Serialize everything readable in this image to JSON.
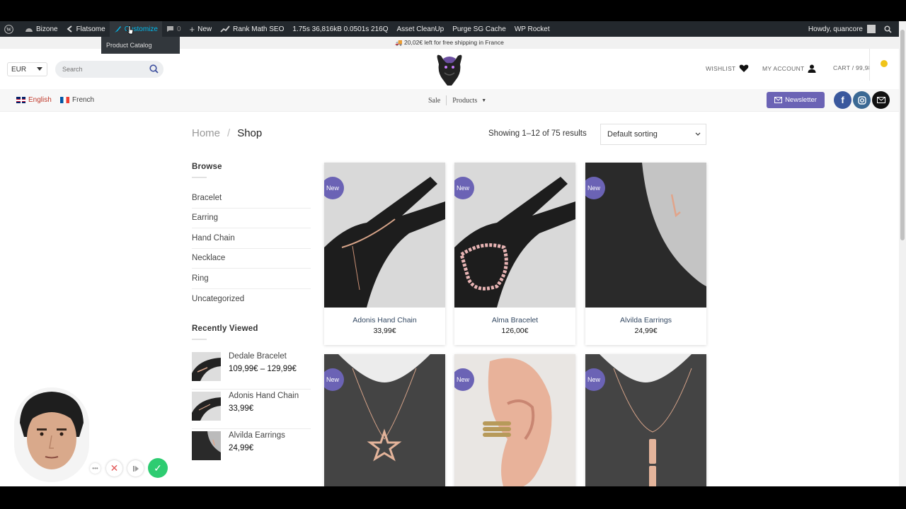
{
  "admin_bar": {
    "site_name": "Bizone",
    "theme": "Flatsome",
    "customize": "Customize",
    "comments_count": "0",
    "new_label": "New",
    "rank_math": "Rank Math SEO",
    "query_stats": "1.75s  36,816kB  0.0501s  216Q",
    "asset_cleanup": "Asset CleanUp",
    "purge_cache": "Purge SG Cache",
    "wp_rocket": "WP Rocket",
    "howdy": "Howdy, quancore",
    "dropdown_item": "Product Catalog"
  },
  "notice": {
    "text": "🚚 20,02€ left for free shipping in France"
  },
  "header": {
    "currency": "EUR",
    "search_placeholder": "Search",
    "wishlist": "WISHLIST",
    "my_account": "MY ACCOUNT",
    "cart": "CART / 99,98"
  },
  "subbar": {
    "lang_english": "English",
    "lang_french": "French",
    "nav_sale": "Sale",
    "nav_products": "Products",
    "newsletter": "Newsletter"
  },
  "shop": {
    "breadcrumb_home": "Home",
    "breadcrumb_sep": "/",
    "breadcrumb_current": "Shop",
    "result_count": "Showing 1–12 of 75 results",
    "sorting": "Default sorting"
  },
  "sidebar": {
    "browse_title": "Browse",
    "categories": [
      "Bracelet",
      "Earring",
      "Hand Chain",
      "Necklace",
      "Ring",
      "Uncategorized"
    ],
    "recently_viewed_title": "Recently Viewed",
    "recent": [
      {
        "name": "Dedale Bracelet",
        "price": "109,99€ – 129,99€"
      },
      {
        "name": "Adonis Hand Chain",
        "price": "33,99€"
      },
      {
        "name": "Alvilda Earrings",
        "price": "24,99€"
      }
    ]
  },
  "products": [
    {
      "badge": "New",
      "name": "Adonis Hand Chain",
      "price": "33,99€"
    },
    {
      "badge": "New",
      "name": "Alma Bracelet",
      "price": "126,00€"
    },
    {
      "badge": "New",
      "name": "Alvilda Earrings",
      "price": "24,99€"
    },
    {
      "badge": "New",
      "name": "",
      "price": ""
    },
    {
      "badge": "New",
      "name": "",
      "price": ""
    },
    {
      "badge": "New",
      "name": "",
      "price": ""
    }
  ],
  "colors": {
    "accent": "#6b63b5",
    "admin_bar": "#23282d",
    "link": "#334862"
  }
}
